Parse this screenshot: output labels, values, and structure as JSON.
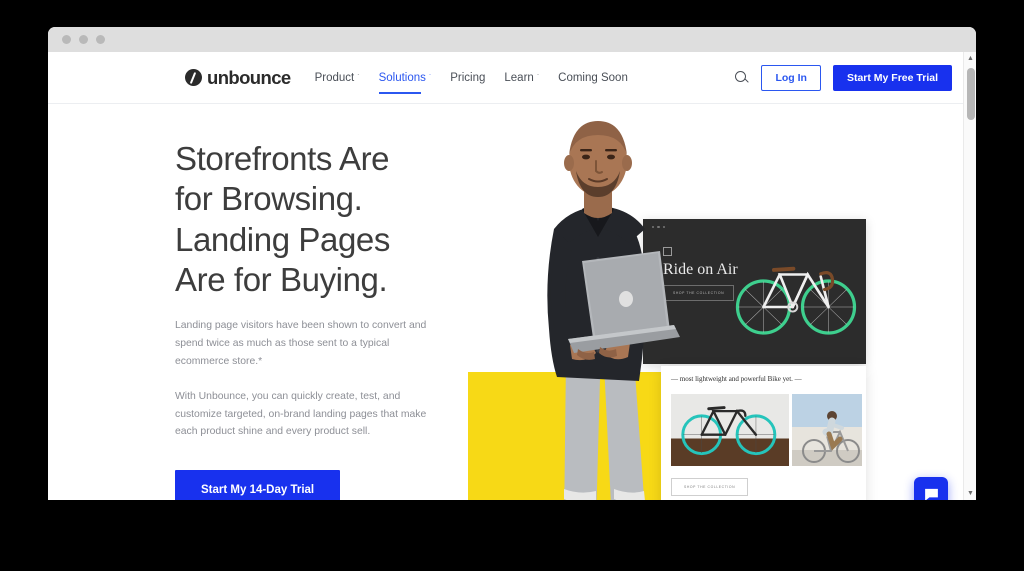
{
  "window": {
    "traffic_lights": [
      "close",
      "minimize",
      "maximize"
    ]
  },
  "nav": {
    "logo_text": "unbounce",
    "links": [
      {
        "label": "Product",
        "caret": "ˇ",
        "active": false
      },
      {
        "label": "Solutions",
        "caret": "ˇ",
        "active": true
      },
      {
        "label": "Pricing",
        "caret": "",
        "active": false
      },
      {
        "label": "Learn",
        "caret": "ˇ",
        "active": false
      },
      {
        "label": "Coming Soon",
        "caret": "",
        "active": false
      }
    ],
    "search_icon": "search-icon",
    "login_label": "Log In",
    "trial_label": "Start My Free Trial"
  },
  "hero": {
    "headline": "Storefronts Are for Browsing. Landing Pages Are for Buying.",
    "paragraph_1": "Landing page visitors have been shown to convert and spend twice as much as those sent to a typical ecommerce store.*",
    "paragraph_2": "With Unbounce, you can quickly create, test, and customize targeted, on-brand landing pages that make each product shine and every product sell.",
    "cta_label": "Start My 14-Day Trial"
  },
  "mockup": {
    "dark_card": {
      "title": "Ride on Air",
      "button_label": "SHOP THE COLLECTION"
    },
    "light_card": {
      "caption": "— most lightweight and powerful Bike yet. —",
      "button_label": "SHOP THE COLLECTION"
    }
  },
  "widgets": {
    "chat_icon": "chat-bubble-icon"
  },
  "scrollbar": {
    "up_arrow": "▲",
    "down_arrow": "▼"
  },
  "colors": {
    "brand_blue": "#1831ee",
    "link_blue": "#2b57f0",
    "yellow": "#f7d916",
    "green": "#36c391",
    "dark_card": "#2c2c2c"
  }
}
